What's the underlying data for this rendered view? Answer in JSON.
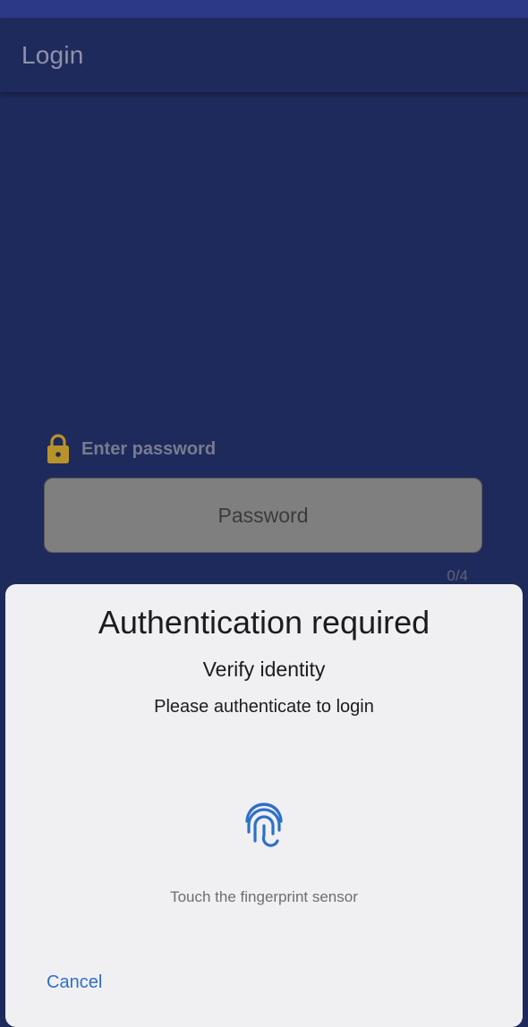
{
  "app_bar": {
    "title": "Login"
  },
  "password": {
    "label": "Enter password",
    "placeholder": "Password",
    "counter": "0/4",
    "icon": "lock-icon"
  },
  "dialog": {
    "title": "Authentication required",
    "subtitle": "Verify identity",
    "description": "Please authenticate to login",
    "fingerprint_hint": "Touch the fingerprint sensor",
    "fingerprint_icon": "fingerprint-icon",
    "cancel_label": "Cancel"
  },
  "colors": {
    "background": "#1f2a5c",
    "status_bar": "#2b3a86",
    "lock": "#b8932a",
    "input_fill": "#7f7f7f",
    "dialog_bg": "#f0f0f3",
    "accent": "#2e6fc7"
  }
}
